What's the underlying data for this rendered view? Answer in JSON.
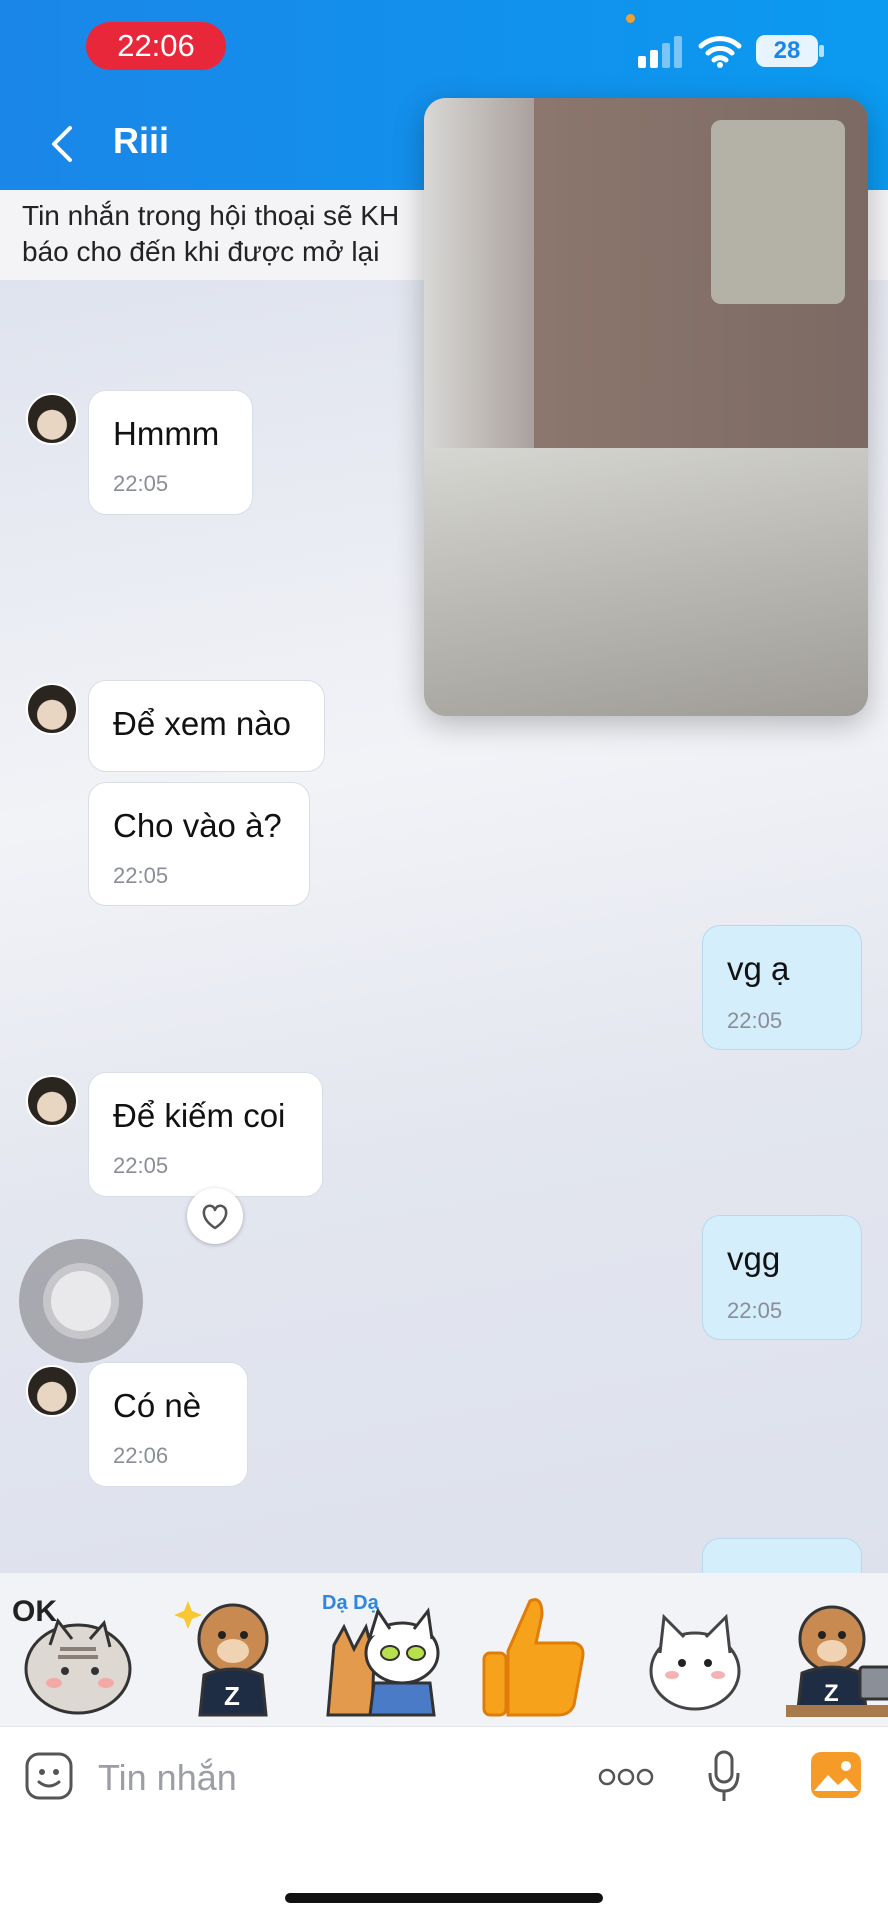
{
  "status_bar": {
    "time": "22:06",
    "battery": "28"
  },
  "header": {
    "title": "Riii"
  },
  "notice": {
    "line1": "Tin nhắn trong hội thoại sẽ KH",
    "line2": "báo cho đến khi được mở lại"
  },
  "messages": [
    {
      "text": "Hmmm",
      "time": "22:05"
    },
    {
      "text": "Để xem nào"
    },
    {
      "text": "Cho vào à?",
      "time": "22:05"
    },
    {
      "text": "vg ạ",
      "time": "22:05"
    },
    {
      "text": "Để kiếm coi",
      "time": "22:05"
    },
    {
      "text": "vgg",
      "time": "22:05"
    },
    {
      "text": "Có nè",
      "time": "22:06"
    }
  ],
  "stickers": [
    {
      "name": "ok-cat-sticker",
      "label": "OK"
    },
    {
      "name": "bear-z-sticker",
      "label": "Z"
    },
    {
      "name": "da-da-cats-sticker",
      "label": "Dạ Dạ"
    },
    {
      "name": "thumbs-up-sticker",
      "label": ""
    },
    {
      "name": "white-cat-sticker",
      "label": ""
    },
    {
      "name": "bear-laptop-sticker",
      "label": "Z"
    }
  ],
  "input": {
    "placeholder": "Tin nhắn"
  },
  "colors": {
    "header": "#1a86e8",
    "time_pill": "#e8283a",
    "my_bubble": "#d5eefc",
    "image_button": "#f79b28"
  },
  "icons": [
    "back-chevron-icon",
    "signal-icon",
    "wifi-icon",
    "battery-icon",
    "heart-icon",
    "emoji-icon",
    "more-icon",
    "microphone-icon",
    "image-icon"
  ]
}
